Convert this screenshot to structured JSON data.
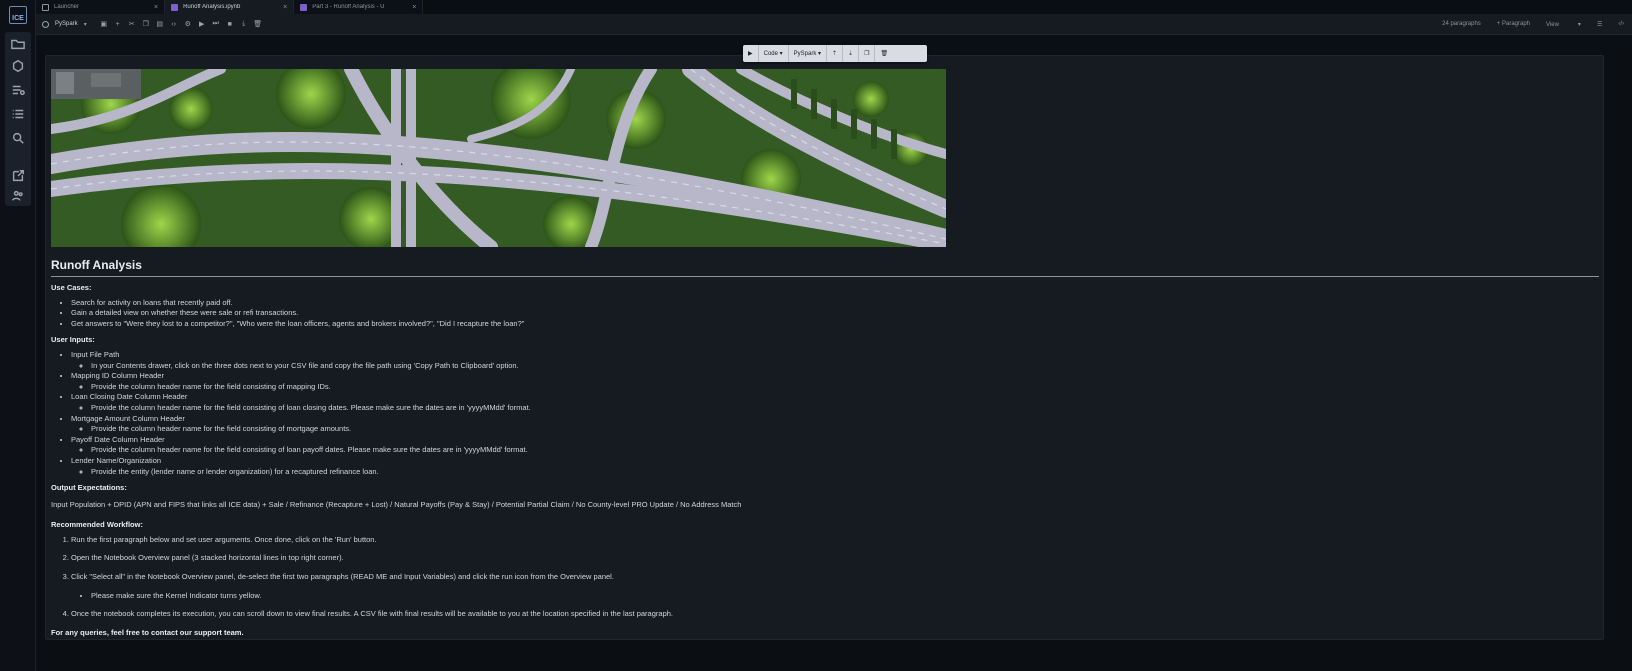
{
  "app": {
    "logo_text": "ICE"
  },
  "tabs": [
    {
      "label": "Launcher",
      "close": "×"
    },
    {
      "label": "Runoff Analysis.ipynb",
      "close": "×"
    },
    {
      "label": "Part 3 - Runoff Analysis - U",
      "close": "×"
    }
  ],
  "toolbar": {
    "kernel": "PySpark",
    "right_items": {
      "paragraphs": "24 paragraphs",
      "add_paragraph": "+ Paragraph",
      "view": "View"
    }
  },
  "cell_toolbar": {
    "run": "▶",
    "cell_type": "Code",
    "kernel": "PySpark"
  },
  "content": {
    "title": "Runoff Analysis",
    "use_cases_heading": "Use Cases:",
    "use_cases": [
      "Search for activity on loans that recently paid off.",
      "Gain a detailed view on whether these were sale or refi transactions.",
      "Get answers to \"Were they lost to a competitor?\", \"Who were the loan officers, agents and brokers involved?\", \"Did I recapture the loan?\""
    ],
    "user_inputs_heading": "User Inputs:",
    "user_inputs": [
      {
        "label": "Input File Path",
        "detail": "In your Contents drawer, click on the three dots next to your CSV file and copy the file path using 'Copy Path to Clipboard' option."
      },
      {
        "label": "Mapping ID Column Header",
        "detail": "Provide the column header name for the field consisting of mapping IDs."
      },
      {
        "label": "Loan Closing Date Column Header",
        "detail": "Provide the column header name for the field consisting of loan closing dates. Please make sure the dates are in 'yyyyMMdd' format."
      },
      {
        "label": "Mortgage Amount Column Header",
        "detail": "Provide the column header name for the field consisting of mortgage amounts."
      },
      {
        "label": "Payoff Date Column Header",
        "detail": "Provide the column header name for the field consisting of loan payoff dates. Please make sure the dates are in 'yyyyMMdd' format."
      },
      {
        "label": "Lender Name/Organization",
        "detail": "Provide the entity (lender name or lender organization) for a recaptured refinance loan."
      }
    ],
    "output_heading": "Output Expectations:",
    "output_text": "Input Population + DPID (APN and FIPS that links all ICE data) + Sale / Refinance (Recapture + Lost) / Natural Payoffs (Pay & Stay) / Potential Partial Claim / No County-level PRO Update / No Address Match",
    "workflow_heading": "Recommended Workflow:",
    "workflow": [
      "Run the first paragraph below and set user arguments. Once done, click on the 'Run' button.",
      "Open the Notebook Overview panel (3 stacked horizontal lines in top right corner).",
      "Click \"Select all\" in the Notebook Overview panel, de-select the first two paragraphs (READ ME and Input Variables) and click the run icon from the Overview panel.",
      "Once the notebook completes its execution, you can scroll down to view final results. A CSV file with final results will be available to you at the location specified in the last paragraph."
    ],
    "workflow_sub": "Please make sure the Kernel Indicator turns yellow.",
    "footer": "For any queries, feel free to contact our support team."
  }
}
